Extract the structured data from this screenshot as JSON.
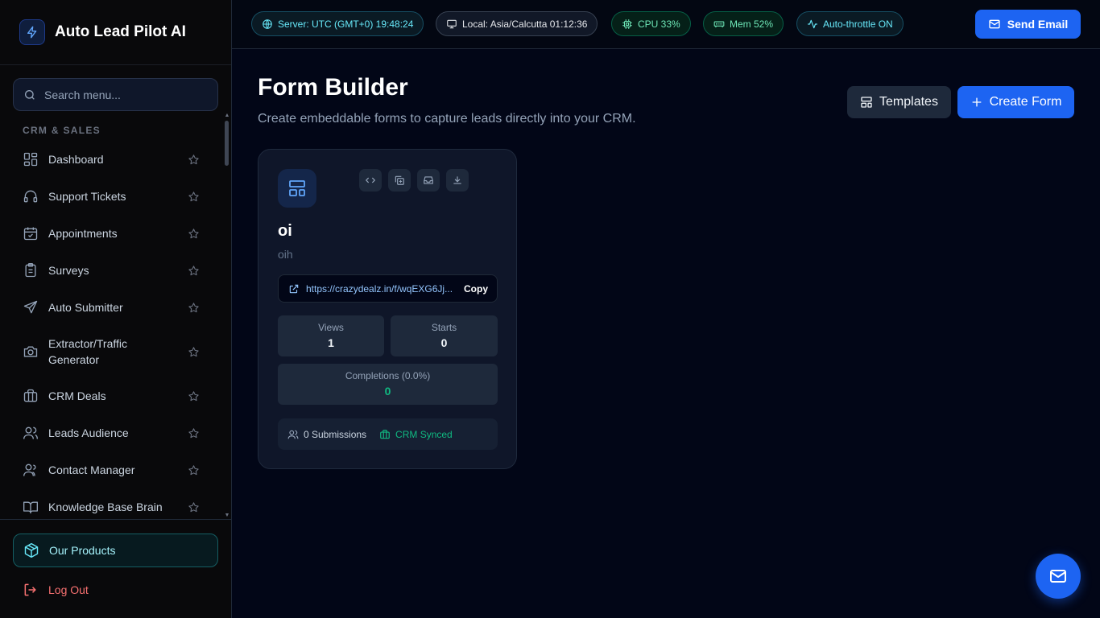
{
  "app": {
    "name": "Auto Lead Pilot AI"
  },
  "sidebar": {
    "search_placeholder": "Search menu...",
    "section": "CRM & SALES",
    "items": [
      {
        "label": "Dashboard",
        "icon": "dashboard-icon"
      },
      {
        "label": "Support Tickets",
        "icon": "headset-icon"
      },
      {
        "label": "Appointments",
        "icon": "calendar-check-icon"
      },
      {
        "label": "Surveys",
        "icon": "clipboard-list-icon"
      },
      {
        "label": "Auto Submitter",
        "icon": "send-icon"
      },
      {
        "label": "Extractor/Traffic Generator",
        "icon": "camera-icon"
      },
      {
        "label": "CRM Deals",
        "icon": "briefcase-icon"
      },
      {
        "label": "Leads Audience",
        "icon": "users-icon"
      },
      {
        "label": "Contact Manager",
        "icon": "contacts-icon"
      },
      {
        "label": "Knowledge Base Brain",
        "icon": "book-open-icon"
      }
    ],
    "products_label": "Our Products",
    "logout_label": "Log Out"
  },
  "topbar": {
    "server": "Server: UTC (GMT+0) 19:48:24",
    "local": "Local: Asia/Calcutta 01:12:36",
    "cpu": "CPU 33%",
    "mem": "Mem 52%",
    "throttle": "Auto-throttle ON",
    "send_email": "Send Email"
  },
  "main": {
    "title": "Form Builder",
    "subtitle": "Create embeddable forms to capture leads directly into your CRM.",
    "templates_label": "Templates",
    "create_label": "Create Form"
  },
  "form_card": {
    "name": "oi",
    "description": "oih",
    "url": "https://crazydealz.in/f/wqEXG6Jj...",
    "copy_label": "Copy",
    "views_label": "Views",
    "views": "1",
    "starts_label": "Starts",
    "starts": "0",
    "completions_label": "Completions (0.0%)",
    "completions": "0",
    "submissions": "0 Submissions",
    "crm_status": "CRM Synced"
  },
  "colors": {
    "accent": "#1d64f2",
    "success": "#10b981",
    "cyan": "#67e8f9",
    "danger": "#f87171",
    "background": "#020617"
  }
}
